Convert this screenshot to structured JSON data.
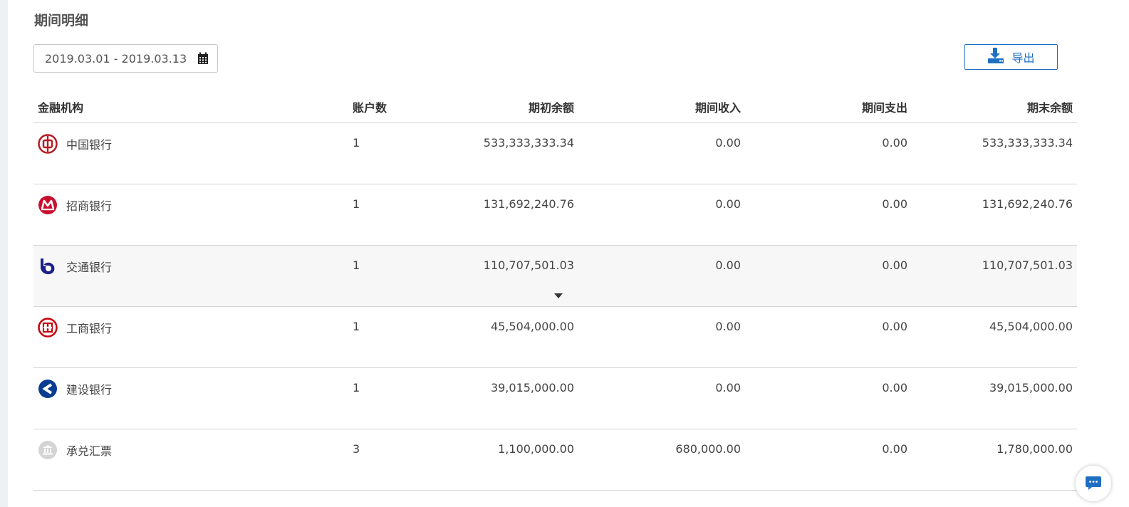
{
  "section_title": "期间明细",
  "date_range": "2019.03.01 - 2019.03.13",
  "export_label": "导出",
  "table": {
    "headers": [
      "金融机构",
      "账户数",
      "期初余额",
      "期间收入",
      "期间支出",
      "期末余额"
    ],
    "rows": [
      {
        "institution": "中国银行",
        "accounts": "1",
        "opening": "533,333,333.34",
        "income": "0.00",
        "expense": "0.00",
        "closing": "533,333,333.34",
        "logo": "boc-logo",
        "color": "#b81c22"
      },
      {
        "institution": "招商银行",
        "accounts": "1",
        "opening": "131,692,240.76",
        "income": "0.00",
        "expense": "0.00",
        "closing": "131,692,240.76",
        "logo": "cmb-logo",
        "color": "#c8102e"
      },
      {
        "institution": "交通银行",
        "accounts": "1",
        "opening": "110,707,501.03",
        "income": "0.00",
        "expense": "0.00",
        "closing": "110,707,501.03",
        "logo": "bocom-logo",
        "color": "#1d2088"
      },
      {
        "institution": "工商银行",
        "accounts": "1",
        "opening": "45,504,000.00",
        "income": "0.00",
        "expense": "0.00",
        "closing": "45,504,000.00",
        "logo": "icbc-logo",
        "color": "#c7000b"
      },
      {
        "institution": "建设银行",
        "accounts": "1",
        "opening": "39,015,000.00",
        "income": "0.00",
        "expense": "0.00",
        "closing": "39,015,000.00",
        "logo": "ccb-logo",
        "color": "#0a3d91"
      },
      {
        "institution": "承兑汇票",
        "accounts": "3",
        "opening": "1,100,000.00",
        "income": "680,000.00",
        "expense": "0.00",
        "closing": "1,780,000.00",
        "logo": "bank-building-icon",
        "color": "#cfcfcf"
      }
    ]
  },
  "colors": {
    "accent": "#1e6fc4",
    "row_highlight": "#f7f7f7"
  }
}
